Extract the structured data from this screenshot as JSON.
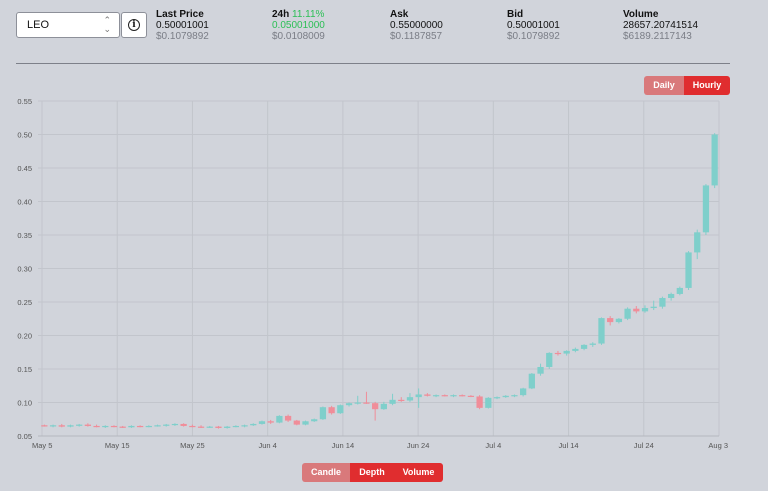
{
  "selector": {
    "value": "LEO"
  },
  "stats": {
    "last_price": {
      "label": "Last Price",
      "value": "0.50001001",
      "usd": "$0.1079892"
    },
    "change_24h": {
      "label": "24h",
      "percent": "11.11%",
      "value": "0.05001000",
      "usd": "$0.0108009"
    },
    "ask": {
      "label": "Ask",
      "value": "0.55000000",
      "usd": "$0.1187857"
    },
    "bid": {
      "label": "Bid",
      "value": "0.50001001",
      "usd": "$0.1079892"
    },
    "volume": {
      "label": "Volume",
      "value": "28657.20741514",
      "usd": "$6189.2117143"
    }
  },
  "period_toggle": {
    "daily": "Daily",
    "hourly": "Hourly",
    "active": "Hourly"
  },
  "chart_tabs": {
    "candle": "Candle",
    "depth": "Depth",
    "volume": "Volume"
  },
  "colors": {
    "up": "#7fcfcb",
    "down": "#f08d99",
    "accent": "#e02d2f"
  },
  "chart_data": {
    "type": "candlestick",
    "ylim": [
      0.05,
      0.55
    ],
    "y_ticks": [
      "0.05",
      "0.10",
      "0.15",
      "0.20",
      "0.25",
      "0.30",
      "0.35",
      "0.40",
      "0.45",
      "0.50",
      "0.55"
    ],
    "x_ticks": [
      "May 5",
      "May 15",
      "May 25",
      "Jun 4",
      "Jun 14",
      "Jun 24",
      "Jul 4",
      "Jul 14",
      "Jul 24",
      "Aug 3"
    ],
    "grid": true,
    "candles": [
      {
        "o": 0.066,
        "h": 0.067,
        "l": 0.064,
        "c": 0.065
      },
      {
        "o": 0.065,
        "h": 0.067,
        "l": 0.063,
        "c": 0.066
      },
      {
        "o": 0.066,
        "h": 0.068,
        "l": 0.063,
        "c": 0.064
      },
      {
        "o": 0.064,
        "h": 0.067,
        "l": 0.063,
        "c": 0.066
      },
      {
        "o": 0.066,
        "h": 0.068,
        "l": 0.064,
        "c": 0.067
      },
      {
        "o": 0.067,
        "h": 0.069,
        "l": 0.064,
        "c": 0.065
      },
      {
        "o": 0.065,
        "h": 0.067,
        "l": 0.063,
        "c": 0.064
      },
      {
        "o": 0.064,
        "h": 0.066,
        "l": 0.062,
        "c": 0.065
      },
      {
        "o": 0.065,
        "h": 0.066,
        "l": 0.063,
        "c": 0.064
      },
      {
        "o": 0.064,
        "h": 0.065,
        "l": 0.062,
        "c": 0.063
      },
      {
        "o": 0.063,
        "h": 0.066,
        "l": 0.062,
        "c": 0.065
      },
      {
        "o": 0.065,
        "h": 0.066,
        "l": 0.063,
        "c": 0.064
      },
      {
        "o": 0.064,
        "h": 0.066,
        "l": 0.063,
        "c": 0.065
      },
      {
        "o": 0.065,
        "h": 0.067,
        "l": 0.064,
        "c": 0.066
      },
      {
        "o": 0.066,
        "h": 0.068,
        "l": 0.064,
        "c": 0.067
      },
      {
        "o": 0.067,
        "h": 0.069,
        "l": 0.065,
        "c": 0.068
      },
      {
        "o": 0.068,
        "h": 0.069,
        "l": 0.064,
        "c": 0.065
      },
      {
        "o": 0.065,
        "h": 0.067,
        "l": 0.063,
        "c": 0.064
      },
      {
        "o": 0.064,
        "h": 0.066,
        "l": 0.062,
        "c": 0.063
      },
      {
        "o": 0.063,
        "h": 0.065,
        "l": 0.062,
        "c": 0.064
      },
      {
        "o": 0.064,
        "h": 0.065,
        "l": 0.061,
        "c": 0.062
      },
      {
        "o": 0.062,
        "h": 0.065,
        "l": 0.061,
        "c": 0.064
      },
      {
        "o": 0.064,
        "h": 0.066,
        "l": 0.063,
        "c": 0.065
      },
      {
        "o": 0.065,
        "h": 0.067,
        "l": 0.063,
        "c": 0.066
      },
      {
        "o": 0.066,
        "h": 0.069,
        "l": 0.065,
        "c": 0.068
      },
      {
        "o": 0.068,
        "h": 0.073,
        "l": 0.067,
        "c": 0.072
      },
      {
        "o": 0.072,
        "h": 0.074,
        "l": 0.068,
        "c": 0.07
      },
      {
        "o": 0.07,
        "h": 0.081,
        "l": 0.069,
        "c": 0.08
      },
      {
        "o": 0.08,
        "h": 0.082,
        "l": 0.071,
        "c": 0.073
      },
      {
        "o": 0.073,
        "h": 0.074,
        "l": 0.066,
        "c": 0.067
      },
      {
        "o": 0.067,
        "h": 0.073,
        "l": 0.066,
        "c": 0.072
      },
      {
        "o": 0.072,
        "h": 0.076,
        "l": 0.071,
        "c": 0.075
      },
      {
        "o": 0.075,
        "h": 0.094,
        "l": 0.074,
        "c": 0.093
      },
      {
        "o": 0.093,
        "h": 0.095,
        "l": 0.082,
        "c": 0.084
      },
      {
        "o": 0.084,
        "h": 0.097,
        "l": 0.083,
        "c": 0.096
      },
      {
        "o": 0.096,
        "h": 0.1,
        "l": 0.094,
        "c": 0.099
      },
      {
        "o": 0.099,
        "h": 0.11,
        "l": 0.097,
        "c": 0.1
      },
      {
        "o": 0.1,
        "h": 0.116,
        "l": 0.098,
        "c": 0.099
      },
      {
        "o": 0.099,
        "h": 0.101,
        "l": 0.073,
        "c": 0.09
      },
      {
        "o": 0.09,
        "h": 0.101,
        "l": 0.089,
        "c": 0.098
      },
      {
        "o": 0.098,
        "h": 0.113,
        "l": 0.096,
        "c": 0.104
      },
      {
        "o": 0.104,
        "h": 0.108,
        "l": 0.101,
        "c": 0.103
      },
      {
        "o": 0.103,
        "h": 0.114,
        "l": 0.101,
        "c": 0.108
      },
      {
        "o": 0.108,
        "h": 0.121,
        "l": 0.092,
        "c": 0.112
      },
      {
        "o": 0.112,
        "h": 0.114,
        "l": 0.109,
        "c": 0.11
      },
      {
        "o": 0.11,
        "h": 0.112,
        "l": 0.108,
        "c": 0.111
      },
      {
        "o": 0.111,
        "h": 0.112,
        "l": 0.109,
        "c": 0.11
      },
      {
        "o": 0.11,
        "h": 0.112,
        "l": 0.108,
        "c": 0.111
      },
      {
        "o": 0.111,
        "h": 0.112,
        "l": 0.109,
        "c": 0.11
      },
      {
        "o": 0.11,
        "h": 0.111,
        "l": 0.108,
        "c": 0.109
      },
      {
        "o": 0.109,
        "h": 0.111,
        "l": 0.09,
        "c": 0.092
      },
      {
        "o": 0.092,
        "h": 0.108,
        "l": 0.091,
        "c": 0.107
      },
      {
        "o": 0.107,
        "h": 0.109,
        "l": 0.105,
        "c": 0.108
      },
      {
        "o": 0.108,
        "h": 0.111,
        "l": 0.107,
        "c": 0.11
      },
      {
        "o": 0.11,
        "h": 0.112,
        "l": 0.108,
        "c": 0.111
      },
      {
        "o": 0.111,
        "h": 0.122,
        "l": 0.109,
        "c": 0.121
      },
      {
        "o": 0.121,
        "h": 0.144,
        "l": 0.12,
        "c": 0.143
      },
      {
        "o": 0.143,
        "h": 0.158,
        "l": 0.14,
        "c": 0.153
      },
      {
        "o": 0.153,
        "h": 0.175,
        "l": 0.15,
        "c": 0.174
      },
      {
        "o": 0.174,
        "h": 0.177,
        "l": 0.17,
        "c": 0.173
      },
      {
        "o": 0.173,
        "h": 0.178,
        "l": 0.17,
        "c": 0.177
      },
      {
        "o": 0.177,
        "h": 0.182,
        "l": 0.175,
        "c": 0.18
      },
      {
        "o": 0.18,
        "h": 0.187,
        "l": 0.178,
        "c": 0.186
      },
      {
        "o": 0.186,
        "h": 0.19,
        "l": 0.183,
        "c": 0.188
      },
      {
        "o": 0.188,
        "h": 0.227,
        "l": 0.186,
        "c": 0.226
      },
      {
        "o": 0.226,
        "h": 0.229,
        "l": 0.215,
        "c": 0.22
      },
      {
        "o": 0.22,
        "h": 0.226,
        "l": 0.218,
        "c": 0.225
      },
      {
        "o": 0.225,
        "h": 0.242,
        "l": 0.223,
        "c": 0.24
      },
      {
        "o": 0.24,
        "h": 0.244,
        "l": 0.233,
        "c": 0.236
      },
      {
        "o": 0.236,
        "h": 0.245,
        "l": 0.234,
        "c": 0.241
      },
      {
        "o": 0.241,
        "h": 0.252,
        "l": 0.238,
        "c": 0.243
      },
      {
        "o": 0.243,
        "h": 0.258,
        "l": 0.24,
        "c": 0.256
      },
      {
        "o": 0.256,
        "h": 0.264,
        "l": 0.252,
        "c": 0.262
      },
      {
        "o": 0.262,
        "h": 0.273,
        "l": 0.26,
        "c": 0.271
      },
      {
        "o": 0.271,
        "h": 0.326,
        "l": 0.268,
        "c": 0.324
      },
      {
        "o": 0.324,
        "h": 0.358,
        "l": 0.314,
        "c": 0.354
      },
      {
        "o": 0.354,
        "h": 0.426,
        "l": 0.35,
        "c": 0.424
      },
      {
        "o": 0.424,
        "h": 0.502,
        "l": 0.42,
        "c": 0.5
      }
    ]
  }
}
